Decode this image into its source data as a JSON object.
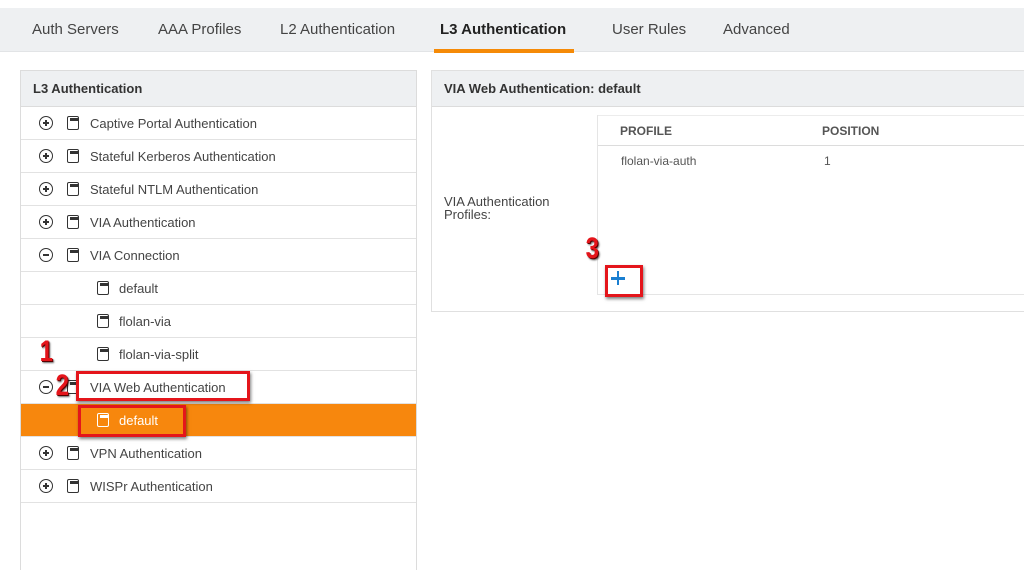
{
  "tabs": [
    {
      "label": "Auth Servers",
      "active": false
    },
    {
      "label": "AAA Profiles",
      "active": false
    },
    {
      "label": "L2 Authentication",
      "active": false
    },
    {
      "label": "L3 Authentication",
      "active": true
    },
    {
      "label": "User Rules",
      "active": false
    },
    {
      "label": "Advanced",
      "active": false
    }
  ],
  "left_panel": {
    "title": "L3 Authentication",
    "items": [
      {
        "label": "Captive Portal Authentication",
        "toggle": "plus",
        "level": 0
      },
      {
        "label": "Stateful Kerberos Authentication",
        "toggle": "plus",
        "level": 0
      },
      {
        "label": "Stateful NTLM Authentication",
        "toggle": "plus",
        "level": 0
      },
      {
        "label": "VIA Authentication",
        "toggle": "plus",
        "level": 0
      },
      {
        "label": "VIA Connection",
        "toggle": "minus",
        "level": 0
      },
      {
        "label": "default",
        "toggle": null,
        "level": 1
      },
      {
        "label": "flolan-via",
        "toggle": null,
        "level": 1
      },
      {
        "label": "flolan-via-split",
        "toggle": null,
        "level": 1
      },
      {
        "label": "VIA Web Authentication",
        "toggle": "minus",
        "level": 0
      },
      {
        "label": "default",
        "toggle": null,
        "level": 1,
        "selected": true
      },
      {
        "label": "VPN Authentication",
        "toggle": "plus",
        "level": 0
      },
      {
        "label": "WISPr Authentication",
        "toggle": "plus",
        "level": 0
      }
    ]
  },
  "right_panel": {
    "title": "VIA Web Authentication: default",
    "field_label": "VIA Authentication Profiles:",
    "table": {
      "columns": [
        "PROFILE",
        "POSITION"
      ],
      "rows": [
        {
          "profile": "flolan-via-auth",
          "position": "1"
        }
      ]
    },
    "add_button_icon": "plus-icon"
  },
  "annotations": [
    {
      "number": "1"
    },
    {
      "number": "2"
    },
    {
      "number": "3"
    }
  ],
  "colors": {
    "accent": "#f58a07",
    "selected_row": "#f7870d",
    "annotation": "#e4151b",
    "add_icon": "#1a7fd1",
    "header_bg": "#eef0f2"
  }
}
